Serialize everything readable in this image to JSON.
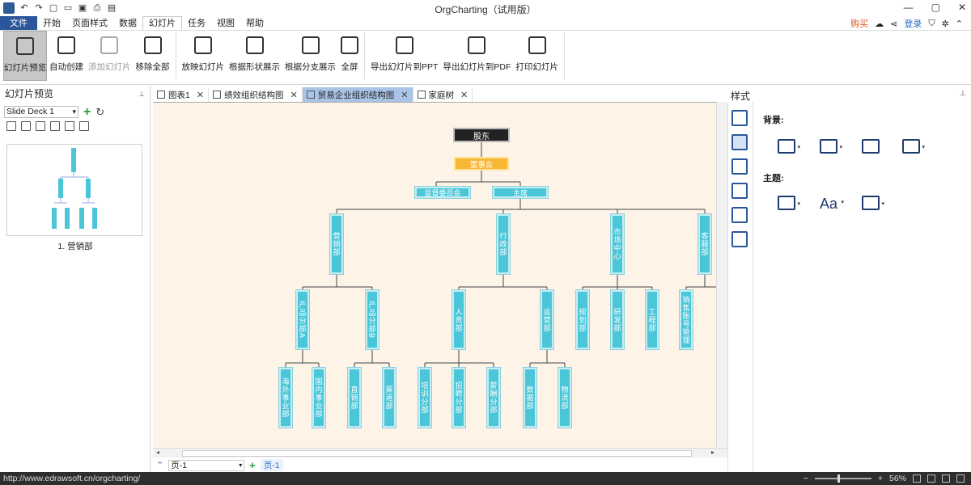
{
  "window": {
    "title": "OrgCharting（试用版）"
  },
  "menu": {
    "file": "文件",
    "items": [
      "开始",
      "页面样式",
      "数据",
      "幻灯片",
      "任务",
      "视图",
      "帮助"
    ],
    "active_index": 3,
    "buy": "购买",
    "login": "登录"
  },
  "ribbon": {
    "buttons": [
      {
        "label": "幻灯片预览",
        "icon": "slide-preview-icon"
      },
      {
        "label": "自动创建",
        "icon": "auto-create-icon"
      },
      {
        "label": "添加幻灯片",
        "icon": "add-slide-icon"
      },
      {
        "label": "移除全部",
        "icon": "remove-all-icon"
      },
      {
        "label": "放映幻灯片",
        "icon": "play-slides-icon"
      },
      {
        "label": "根据形状展示",
        "icon": "show-by-shape-icon"
      },
      {
        "label": "根据分支展示",
        "icon": "show-by-branch-icon"
      },
      {
        "label": "全屏",
        "icon": "fullscreen-icon"
      },
      {
        "label": "导出幻灯片到PPT",
        "icon": "export-ppt-icon"
      },
      {
        "label": "导出幻灯片到PDF",
        "icon": "export-pdf-icon"
      },
      {
        "label": "打印幻灯片",
        "icon": "print-icon"
      }
    ]
  },
  "left_panel": {
    "title": "幻灯片预览",
    "deck": "Slide Deck 1",
    "slide_label": "1. 营销部"
  },
  "tabs": [
    {
      "label": "图表1",
      "active": false
    },
    {
      "label": "绩效组织结构图",
      "active": false
    },
    {
      "label": "贸易企业组织结构图",
      "active": true
    },
    {
      "label": "家庭树",
      "active": false
    }
  ],
  "page_bar": {
    "select": "页-1",
    "page_tab": "页-1"
  },
  "style_panel": {
    "title": "样式",
    "background_label": "背景:",
    "theme_label": "主题:"
  },
  "org": {
    "root": "股东",
    "board": "董事会",
    "level2": [
      "监督委员会",
      "主席"
    ],
    "depts": [
      "营销部",
      "行政部",
      "市场中心",
      "客服部"
    ],
    "marketing_sub": [
      "产品分部A",
      "产品分部B"
    ],
    "marketing_leaves": [
      "海外事业部",
      "国内事业部",
      "直销部",
      "渠道部"
    ],
    "admin_sub": [
      "人资部",
      "运营部"
    ],
    "admin_leaves": [
      "培训分部",
      "招聘分部",
      "薪酬分部",
      "数据部",
      "物流部"
    ],
    "market_sub": [
      "规划部",
      "研发部",
      "工程部"
    ],
    "service_sub": [
      "销售账号管理"
    ]
  },
  "status": {
    "url": "http://www.edrawsoft.cn/orgcharting/",
    "zoom": "56%"
  },
  "colors": {
    "node": "#4bc6d8",
    "board": "#f7b634",
    "root": "#222222",
    "canvas": "#fdf3e7",
    "accent": "#2b579a"
  }
}
